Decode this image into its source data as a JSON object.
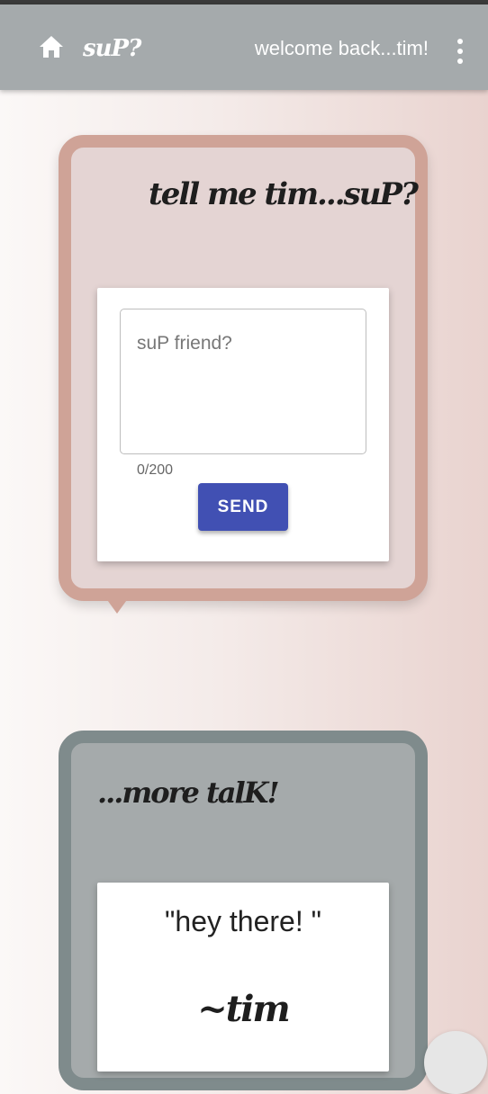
{
  "app": {
    "brand": "suP?",
    "welcome": "welcome back...tim!"
  },
  "icons": {
    "home": "home-icon",
    "menu": "more-vert-icon"
  },
  "compose": {
    "title": "tell me tim...suP?",
    "placeholder": "suP friend?",
    "counter": "0/200",
    "send_label": "SEND"
  },
  "feed": {
    "title": "...more talK!",
    "quote": "\"hey there! \"",
    "author": "~tim"
  },
  "colors": {
    "appbar": "#a5aaac",
    "card1_border": "#cfa397",
    "card2_border": "#7f8b8c",
    "send_button": "#4150b3"
  }
}
